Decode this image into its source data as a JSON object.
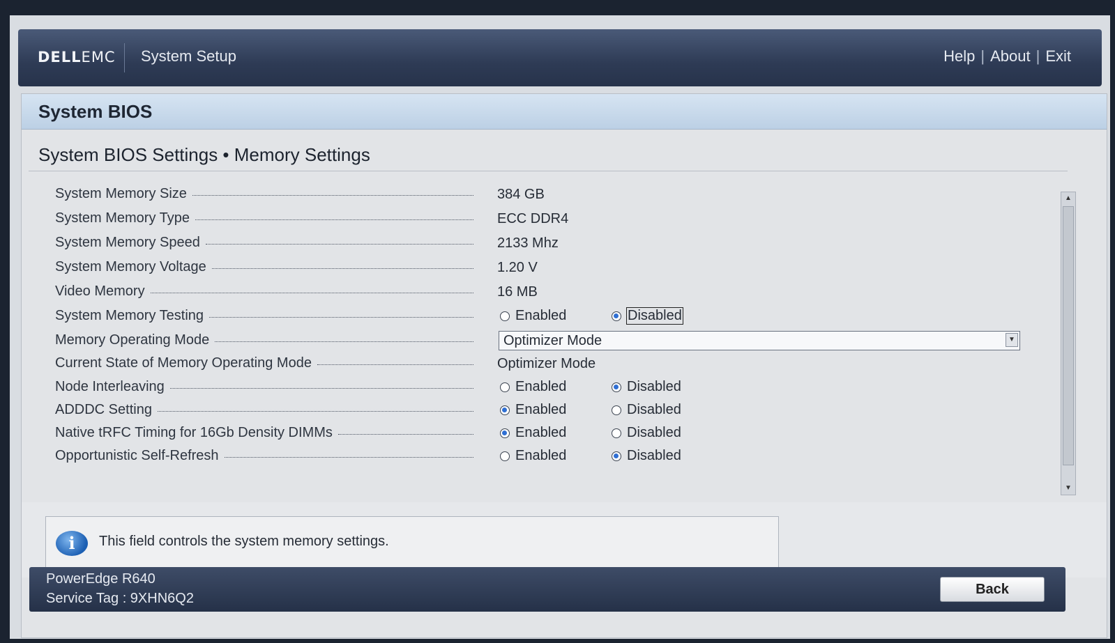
{
  "header": {
    "logo_dell": "DELL",
    "logo_emc": "EMC",
    "app_title": "System Setup",
    "links": {
      "help": "Help",
      "about": "About",
      "exit": "Exit",
      "sep": "|"
    }
  },
  "panel": {
    "title": "System BIOS",
    "breadcrumb": "System BIOS Settings • Memory Settings"
  },
  "radio_labels": {
    "enabled": "Enabled",
    "disabled": "Disabled"
  },
  "settings": [
    {
      "label": "System Memory Size",
      "value": "384 GB"
    },
    {
      "label": "System Memory Type",
      "value": "ECC DDR4"
    },
    {
      "label": "System Memory Speed",
      "value": "2133 Mhz"
    },
    {
      "label": "System Memory Voltage",
      "value": "1.20 V"
    },
    {
      "label": "Video Memory",
      "value": "16 MB"
    },
    {
      "label": "System Memory Testing",
      "selected": "Disabled"
    },
    {
      "label": "Memory Operating Mode",
      "select_value": "Optimizer Mode"
    },
    {
      "label": "Current State of Memory Operating Mode",
      "value": "Optimizer Mode"
    },
    {
      "label": "Node Interleaving",
      "selected": "Disabled"
    },
    {
      "label": "ADDDC Setting",
      "selected": "Enabled"
    },
    {
      "label": "Native tRFC Timing for 16Gb Density DIMMs",
      "selected": "Enabled"
    },
    {
      "label": "Opportunistic Self-Refresh",
      "selected": "Disabled"
    }
  ],
  "info": {
    "icon": "info-icon",
    "text": "This field controls the system memory settings."
  },
  "footer": {
    "model": "PowerEdge R640",
    "service_tag": "Service Tag : 9XHN6Q2",
    "back_label": "Back"
  },
  "colors": {
    "accent_radio": "#2f6fd3",
    "topbar": "#2e3b55",
    "panel_header": "#bcd0e5"
  }
}
